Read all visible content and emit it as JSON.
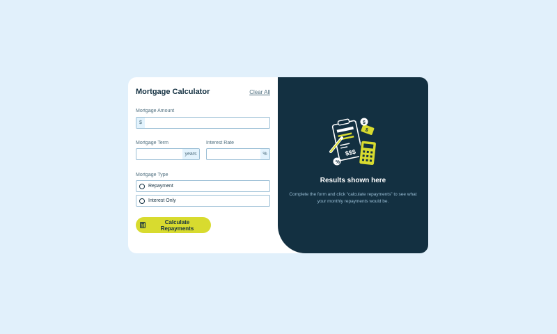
{
  "calculator": {
    "title": "Mortgage Calculator",
    "clear_label": "Clear All",
    "amount": {
      "label": "Mortgage Amount",
      "prefix": "$",
      "value": ""
    },
    "term": {
      "label": "Mortgage Term",
      "suffix": "years",
      "value": ""
    },
    "rate": {
      "label": "Interest Rate",
      "suffix": "%",
      "value": ""
    },
    "type": {
      "label": "Mortgage Type",
      "options": [
        {
          "label": "Repayment",
          "selected": false
        },
        {
          "label": "Interest Only",
          "selected": false
        }
      ]
    },
    "submit_label": "Calculate Repayments"
  },
  "results": {
    "title": "Results shown here",
    "description": "Complete the form and click “calculate repayments” to see what your monthly repayments would be."
  },
  "colors": {
    "background": "#e1f0fb",
    "dark": "#133041",
    "accent": "#d8db2f",
    "border": "#9abed5"
  },
  "icons": [
    "calculator-icon",
    "empty-results-illustration"
  ]
}
